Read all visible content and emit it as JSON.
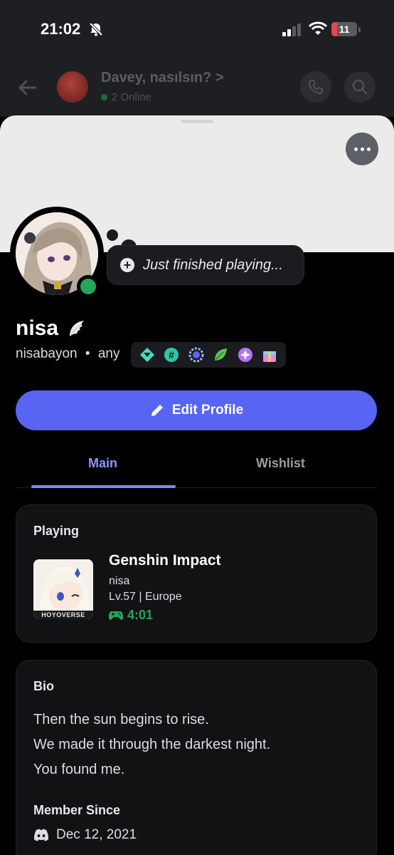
{
  "status_bar": {
    "time": "21:02",
    "battery": "11"
  },
  "channel": {
    "title": "Davey, nasılsın?",
    "chevron": ">",
    "online": "2 Online"
  },
  "profile": {
    "status_prompt": "Just finished playing...",
    "display_name": "nisa",
    "username": "nisabayon",
    "separator": "•",
    "pronouns": "any",
    "badge_icons": [
      "hypesquad-balance-icon",
      "hashtag-quest-icon",
      "laurel-icon",
      "leaf-icon",
      "nitro-icon",
      "gift-icon"
    ],
    "accent_color": "#5865f2",
    "online_color": "#23a55a"
  },
  "actions": {
    "edit_profile": "Edit Profile"
  },
  "tabs": [
    {
      "label": "Main",
      "active": true
    },
    {
      "label": "Wishlist",
      "active": false
    }
  ],
  "playing": {
    "label": "Playing",
    "game": "Genshin Impact",
    "details": "nisa",
    "state": "Lv.57 | Europe",
    "elapsed": "4:01",
    "publisher_mark": "HOYOVERSE"
  },
  "bio": {
    "label": "Bio",
    "lines": [
      "Then the sun begins to rise.",
      "We made it through the darkest night.",
      "You found me."
    ]
  },
  "member_since": {
    "label": "Member Since",
    "date": "Dec 12, 2021"
  }
}
